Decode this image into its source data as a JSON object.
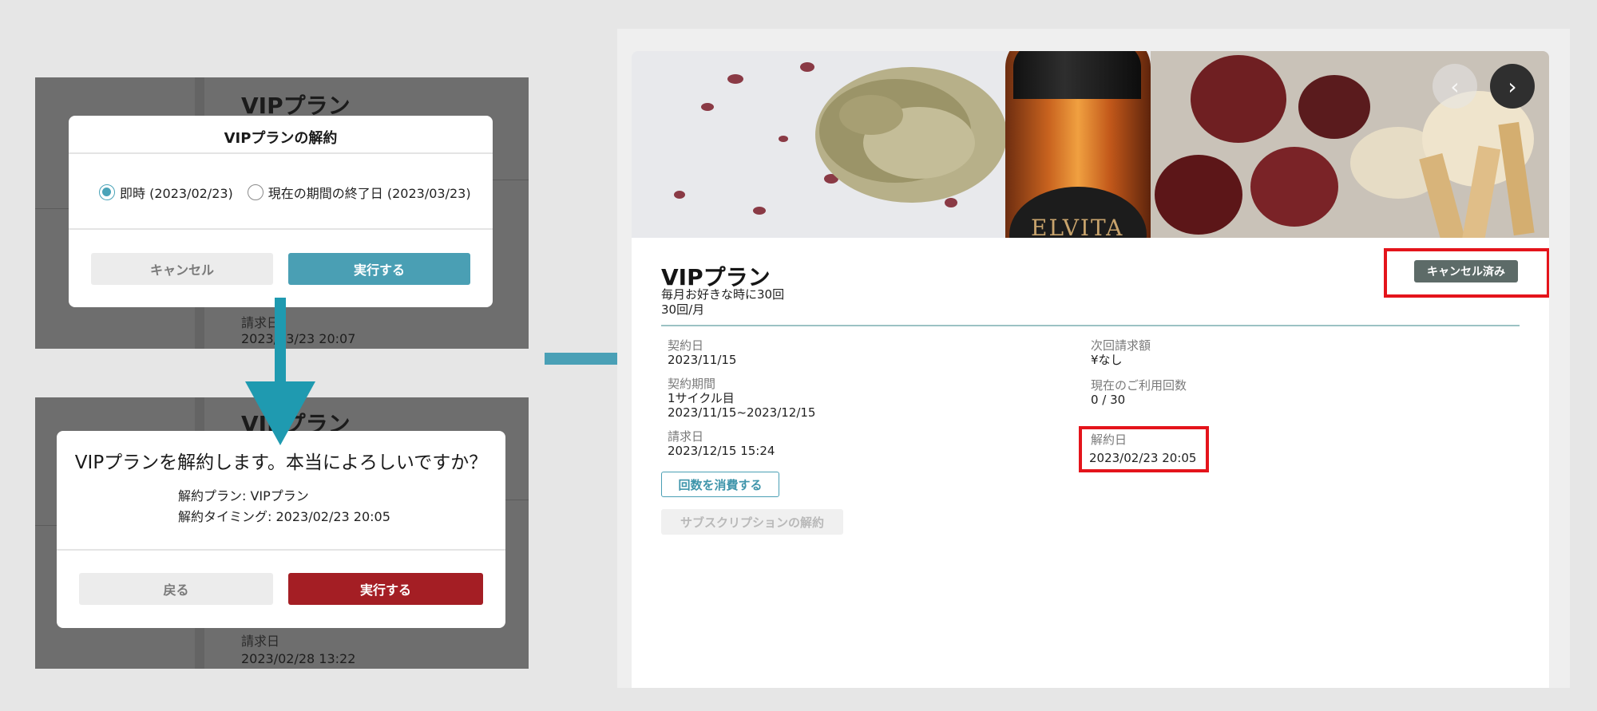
{
  "step1": {
    "background": {
      "plan_title": "VIPプラン",
      "billing_label": "請求日",
      "billing_value": "2023/03/23 20:07"
    },
    "modal": {
      "title": "VIPプランの解約",
      "option_immediate": "即時 (2023/02/23)",
      "option_period_end": "現在の期間の終了日 (2023/03/23)",
      "selected": "option_immediate",
      "cancel_label": "キャンセル",
      "execute_label": "実行する"
    }
  },
  "step2": {
    "background": {
      "plan_title": "VIPプラン",
      "billing_label": "請求日",
      "billing_value": "2023/02/28 13:22"
    },
    "modal": {
      "title": "VIPプランを解約します。本当によろしいですか？",
      "plan_line": "解約プラン: VIPプラン",
      "timing_line": "解約タイミング: 2023/02/23 20:05",
      "back_label": "戻る",
      "execute_label": "実行する"
    }
  },
  "detail": {
    "banner": {
      "bottle_text": "ELVITA",
      "prev_icon": "chevron-left-icon",
      "next_icon": "chevron-right-icon"
    },
    "plan_title": "VIPプラン",
    "plan_desc": "毎月お好きな時に30回",
    "plan_freq": "30回/月",
    "status": "キャンセル済み",
    "fields": {
      "contract_date_label": "契約日",
      "contract_date": "2023/11/15",
      "contract_period_label": "契約期間",
      "contract_cycle": "1サイクル目",
      "contract_range": "2023/11/15~2023/12/15",
      "billing_date_label": "請求日",
      "billing_date": "2023/12/15 15:24",
      "next_amount_label": "次回請求額",
      "next_amount": "¥なし",
      "usage_label": "現在のご利用回数",
      "usage": "0 / 30",
      "cancel_date_label": "解約日",
      "cancel_date": "2023/02/23 20:05"
    },
    "consume_button": "回数を消費する",
    "unsubscribe_button": "サブスクリプションの解約"
  },
  "colors": {
    "teal": "#4a9fb4",
    "red_button": "#a41e24",
    "highlight_border": "#e4141b",
    "status_badge": "#5d6b68",
    "overlay": "#6e6e6e"
  }
}
